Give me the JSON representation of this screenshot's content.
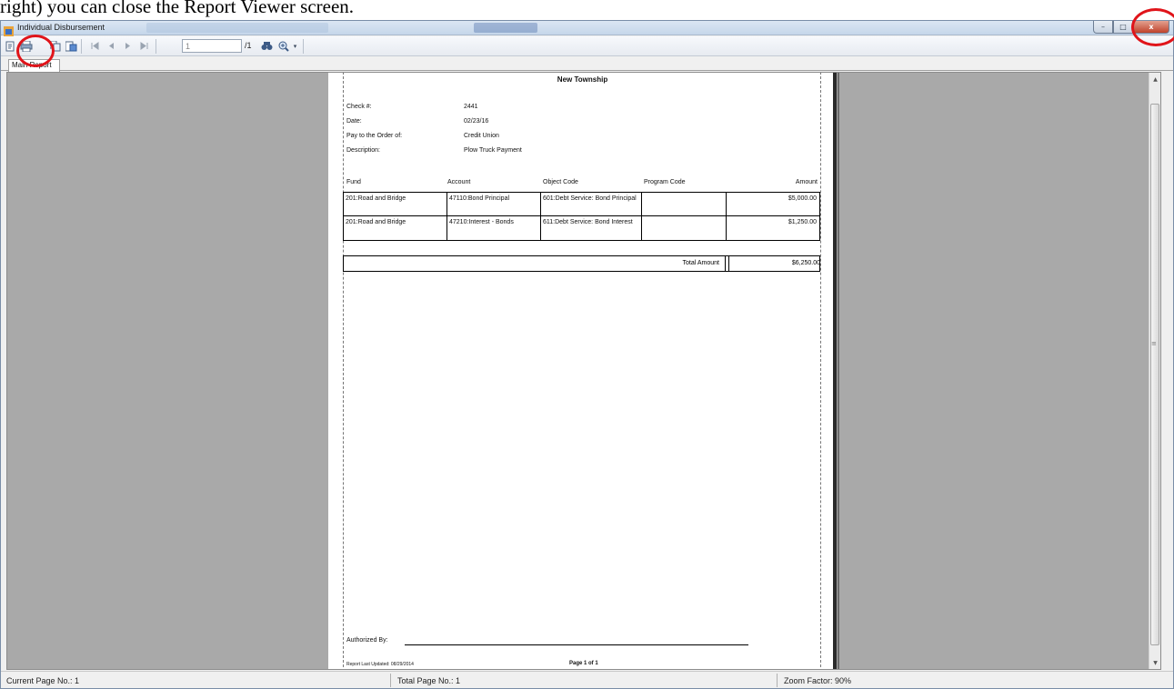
{
  "document": {
    "caption": "right) you can close the Report Viewer screen."
  },
  "window": {
    "title": "Individual Disbursement",
    "controls": {
      "minimize": "–",
      "maximize": "□",
      "close": "x"
    }
  },
  "toolbar": {
    "page_input": "1",
    "page_total": "/1",
    "icons": [
      "export-icon",
      "print-icon",
      "copy-icon",
      "page-setup-icon",
      "first-page-icon",
      "prev-page-icon",
      "next-page-icon",
      "last-page-icon",
      "find-icon",
      "zoom-icon",
      "zoom-dropdown-icon"
    ]
  },
  "tabs": [
    {
      "label": "Main Report"
    }
  ],
  "report": {
    "title": "New Township",
    "fields": [
      {
        "label": "Check #:",
        "value": "2441"
      },
      {
        "label": "Date:",
        "value": "02/23/16"
      },
      {
        "label": "Pay to the Order of:",
        "value": "Credit Union"
      },
      {
        "label": "Description:",
        "value": "Plow Truck Payment"
      }
    ],
    "columns": [
      "Fund",
      "Account",
      "Object Code",
      "Program Code",
      "Amount"
    ],
    "rows": [
      {
        "fund": "201:Road and Bridge",
        "account": "47110:Bond Principal",
        "object_code": "601:Debt Service: Bond Principal",
        "program_code": "",
        "amount": "$5,000.00"
      },
      {
        "fund": "201:Road and Bridge",
        "account": "47210:Interest - Bonds",
        "object_code": "611:Debt Service: Bond Interest",
        "program_code": "",
        "amount": "$1,250.00"
      }
    ],
    "total_label": "Total Amount",
    "total_value": "$6,250.00",
    "authorized_by": "Authorized By:",
    "footer_left": "Report Last Updated: 08/29/2014",
    "footer_center": "Page 1 of 1"
  },
  "statusbar": {
    "current_page": "Current Page No.: 1",
    "total_page": "Total Page No.: 1",
    "zoom": "Zoom Factor: 90%"
  },
  "colors": {
    "annotation": "#e0141a",
    "viewer_bg": "#a9a9a9",
    "close_button": "#c0432c"
  }
}
